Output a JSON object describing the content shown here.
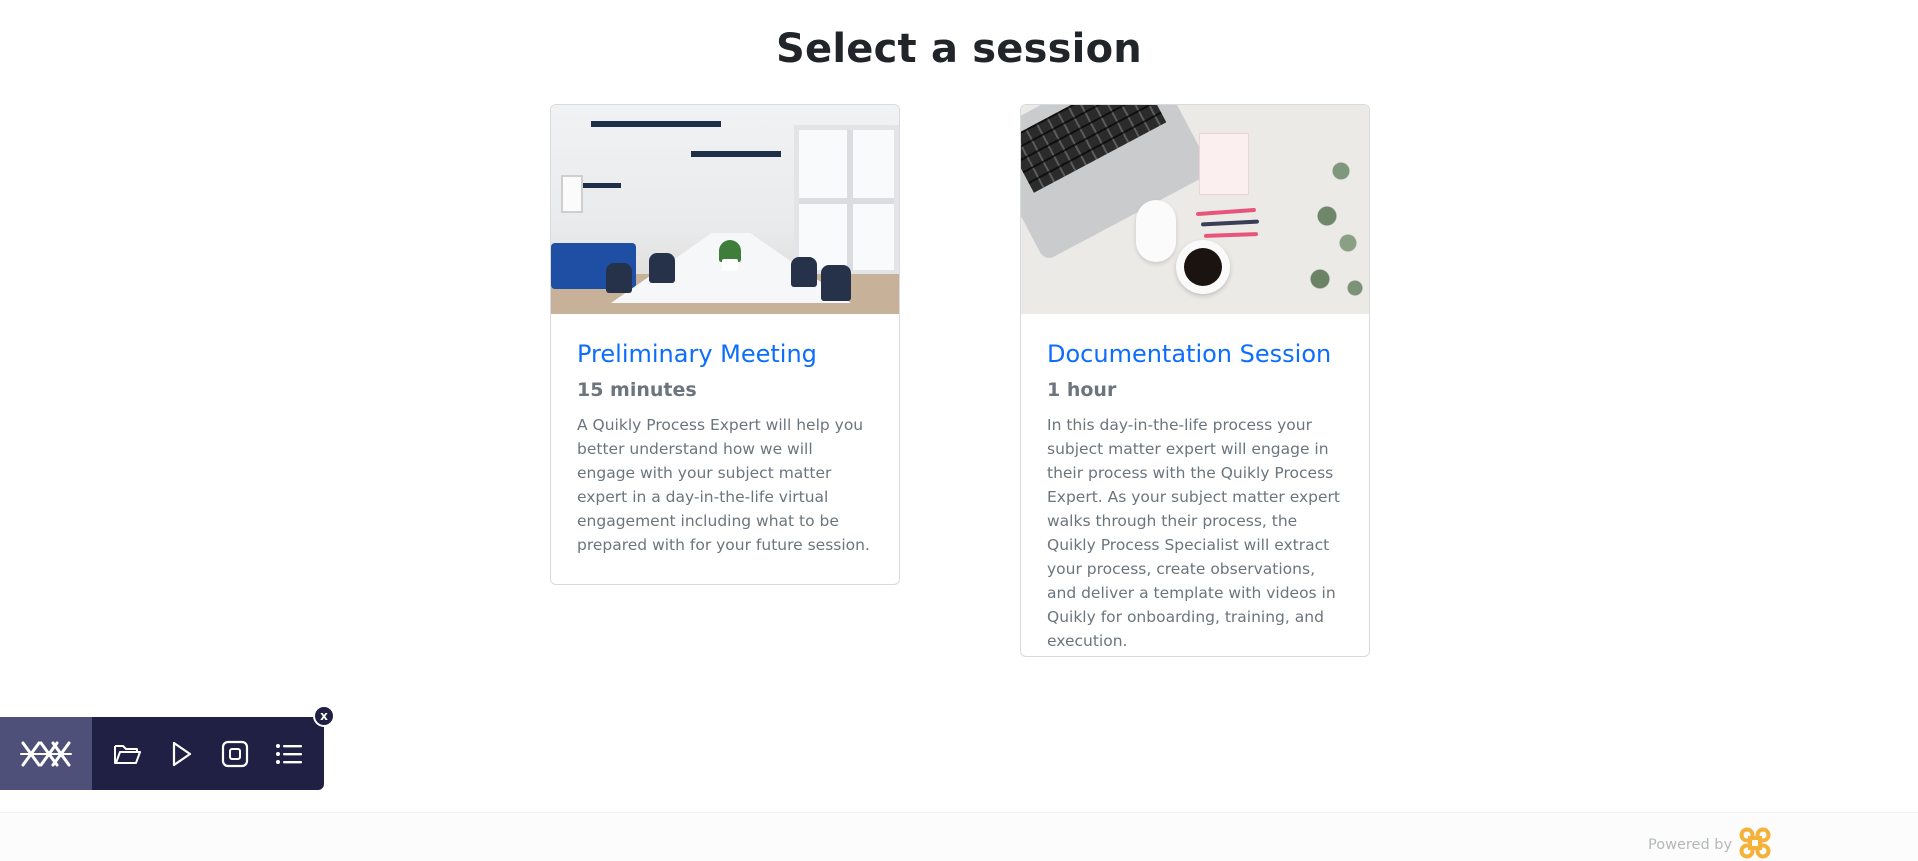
{
  "page": {
    "title": "Select a session"
  },
  "sessions": [
    {
      "title": "Preliminary Meeting",
      "duration": "15 minutes",
      "description": "A Quikly Process Expert will help you better understand how we will engage with your subject matter expert in a day-in-the-life virtual engagement including what to be prepared with for your future session.",
      "image": "meeting-room-photo"
    },
    {
      "title": "Documentation Session",
      "duration": "1 hour",
      "description": "In this day-in-the-life process your subject matter expert will engage in their process with the Quikly Process Expert. As your subject matter expert walks through their process, the Quikly Process Specialist will extract your process, create observations, and deliver a template with videos in Quikly for onboarding, training, and execution.",
      "image": "desk-flatlay-photo"
    }
  ],
  "toolbar": {
    "logo_icon": "recorder-logo-icon",
    "buttons": [
      "folder-open-icon",
      "play-icon",
      "stop-record-icon",
      "list-icon"
    ],
    "close_label": "x"
  },
  "footer": {
    "powered_by_label": "Powered by",
    "logo_icon": "quikly-command-logo-icon"
  },
  "colors": {
    "link": "#0d6efd",
    "muted": "#6c757d",
    "toolbar_bg": "#1f2044",
    "toolbar_logo_bg": "#4e5079",
    "brand_logo": "#f5b23a"
  }
}
